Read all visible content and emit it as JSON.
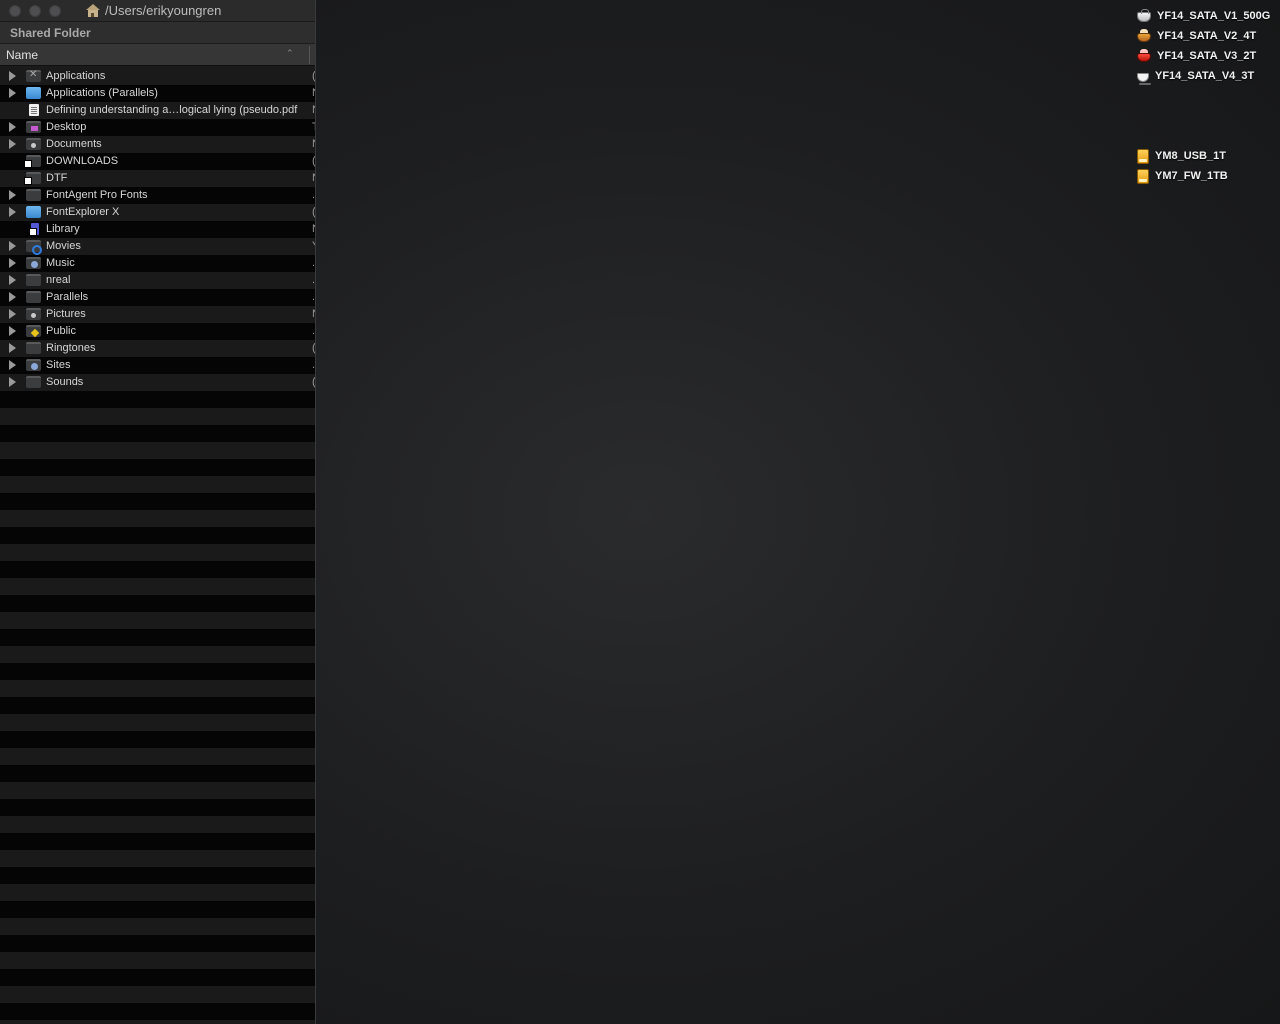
{
  "window": {
    "title": "/Users/erikyoungren",
    "header": "Shared Folder",
    "column_name": "Name"
  },
  "rows": [
    {
      "name": "Applications",
      "expandable": true,
      "icon": "applications-folder-icon",
      "trunc": "("
    },
    {
      "name": "Applications (Parallels)",
      "expandable": true,
      "icon": "parallels-folder-icon",
      "trunc": "N"
    },
    {
      "name": "Defining understanding a…logical lying (pseudo.pdf",
      "expandable": false,
      "icon": "pdf-document-icon",
      "trunc": "N"
    },
    {
      "name": "Desktop",
      "expandable": true,
      "icon": "desktop-folder-icon",
      "trunc": "T"
    },
    {
      "name": "Documents",
      "expandable": true,
      "icon": "documents-folder-icon",
      "trunc": "N"
    },
    {
      "name": "DOWNLOADS",
      "expandable": false,
      "icon": "alias-folder-icon",
      "trunc": "("
    },
    {
      "name": "DTF",
      "expandable": false,
      "icon": "alias-folder-icon",
      "trunc": "N"
    },
    {
      "name": "FontAgent Pro Fonts",
      "expandable": true,
      "icon": "folder-icon",
      "trunc": "."
    },
    {
      "name": "FontExplorer X",
      "expandable": true,
      "icon": "fontexplorer-folder-icon",
      "trunc": "("
    },
    {
      "name": "Library",
      "expandable": false,
      "icon": "library-alias-icon",
      "trunc": "N"
    },
    {
      "name": "Movies",
      "expandable": true,
      "icon": "movies-folder-icon",
      "trunc": "Y"
    },
    {
      "name": "Music",
      "expandable": true,
      "icon": "music-folder-icon",
      "trunc": "."
    },
    {
      "name": "nreal",
      "expandable": true,
      "icon": "folder-icon",
      "trunc": "."
    },
    {
      "name": "Parallels",
      "expandable": true,
      "icon": "folder-icon",
      "trunc": "."
    },
    {
      "name": "Pictures",
      "expandable": true,
      "icon": "pictures-folder-icon",
      "trunc": "N"
    },
    {
      "name": "Public",
      "expandable": true,
      "icon": "public-folder-icon",
      "trunc": "."
    },
    {
      "name": "Ringtones",
      "expandable": true,
      "icon": "folder-icon",
      "trunc": "("
    },
    {
      "name": "Sites",
      "expandable": true,
      "icon": "sites-folder-icon",
      "trunc": "."
    },
    {
      "name": "Sounds",
      "expandable": true,
      "icon": "folder-icon",
      "trunc": "("
    }
  ],
  "desktop": {
    "volumes": [
      {
        "label": "YF14_SATA_V1_500G",
        "icon": "white-disk-icon"
      },
      {
        "label": "YF14_SATA_V2_4T",
        "icon": "orange-disk-icon"
      },
      {
        "label": "YF14_SATA_V3_2T",
        "icon": "red-disk-icon"
      },
      {
        "label": "YF14_SATA_V4_3T",
        "icon": "cup-disk-icon"
      }
    ],
    "external": [
      {
        "label": "YM8_USB_1T",
        "icon": "usb-drive-icon"
      },
      {
        "label": "YM7_FW_1TB",
        "icon": "firewire-drive-icon"
      }
    ]
  }
}
